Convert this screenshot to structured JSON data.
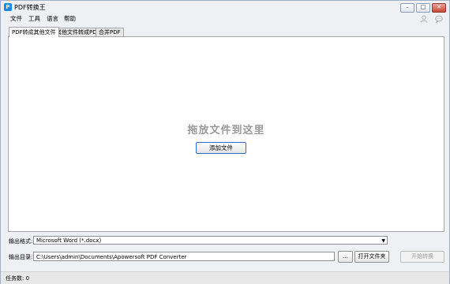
{
  "window": {
    "icon_letter": "P",
    "title": "PDF转换王",
    "controls": {
      "minimize": "–",
      "maximize": "□",
      "close": "✕"
    }
  },
  "menu": [
    "文件",
    "工具",
    "语言",
    "帮助"
  ],
  "top_icons": {
    "user": "user-icon",
    "chat": "chat-icon"
  },
  "tabs": [
    {
      "label": "PDF转成其他文件",
      "active": true
    },
    {
      "label": "其他文件转成PDF",
      "active": false
    },
    {
      "label": "合并PDF",
      "active": false
    }
  ],
  "drop_area": {
    "hint": "拖放文件到这里",
    "add_button": "添加文件"
  },
  "output": {
    "format_label": "输出格式:",
    "format_value": "Microsoft Word (*.docx)",
    "dir_label": "输出目录:",
    "dir_value": "C:\\Users\\admin\\Documents\\Apowersoft PDF Converter",
    "browse_button": "...",
    "open_folder_button": "打开文件夹",
    "start_button": "开始转换"
  },
  "status": {
    "task_count": "任务数: 0"
  }
}
